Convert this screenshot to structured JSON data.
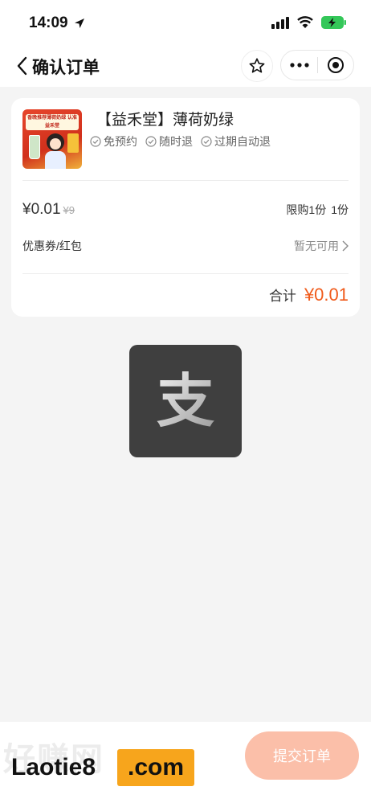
{
  "status_bar": {
    "time": "14:09",
    "icons": [
      "location-arrow-icon",
      "signal-icon",
      "wifi-icon",
      "battery-charging-icon"
    ],
    "battery_color": "#34c759"
  },
  "nav": {
    "title": "确认订单",
    "icons": [
      "back-chevron-icon",
      "star-icon",
      "more-dots-icon",
      "close-target-icon"
    ]
  },
  "product": {
    "name": "【益禾堂】薄荷奶绿",
    "thumbnail_text": "香晚推荐薄荷奶绿 认准益禾堂",
    "badges": [
      "免预约",
      "随时退",
      "过期自动退"
    ]
  },
  "price": {
    "current": "¥0.01",
    "original": "¥9",
    "limit": "限购1份",
    "quantity": "1份"
  },
  "coupon": {
    "label": "优惠券/红包",
    "value": "暂无可用"
  },
  "total": {
    "label": "合计",
    "value": "¥0.01",
    "color": "#f05a1a"
  },
  "alipay": {
    "logo_glyph": "支"
  },
  "footer": {
    "brand_name": "Laotie8",
    "brand_domain": ".com",
    "brand_bg_text": "好赚网",
    "submit_label": "提交订单",
    "submit_color": "#fbbfa9"
  }
}
